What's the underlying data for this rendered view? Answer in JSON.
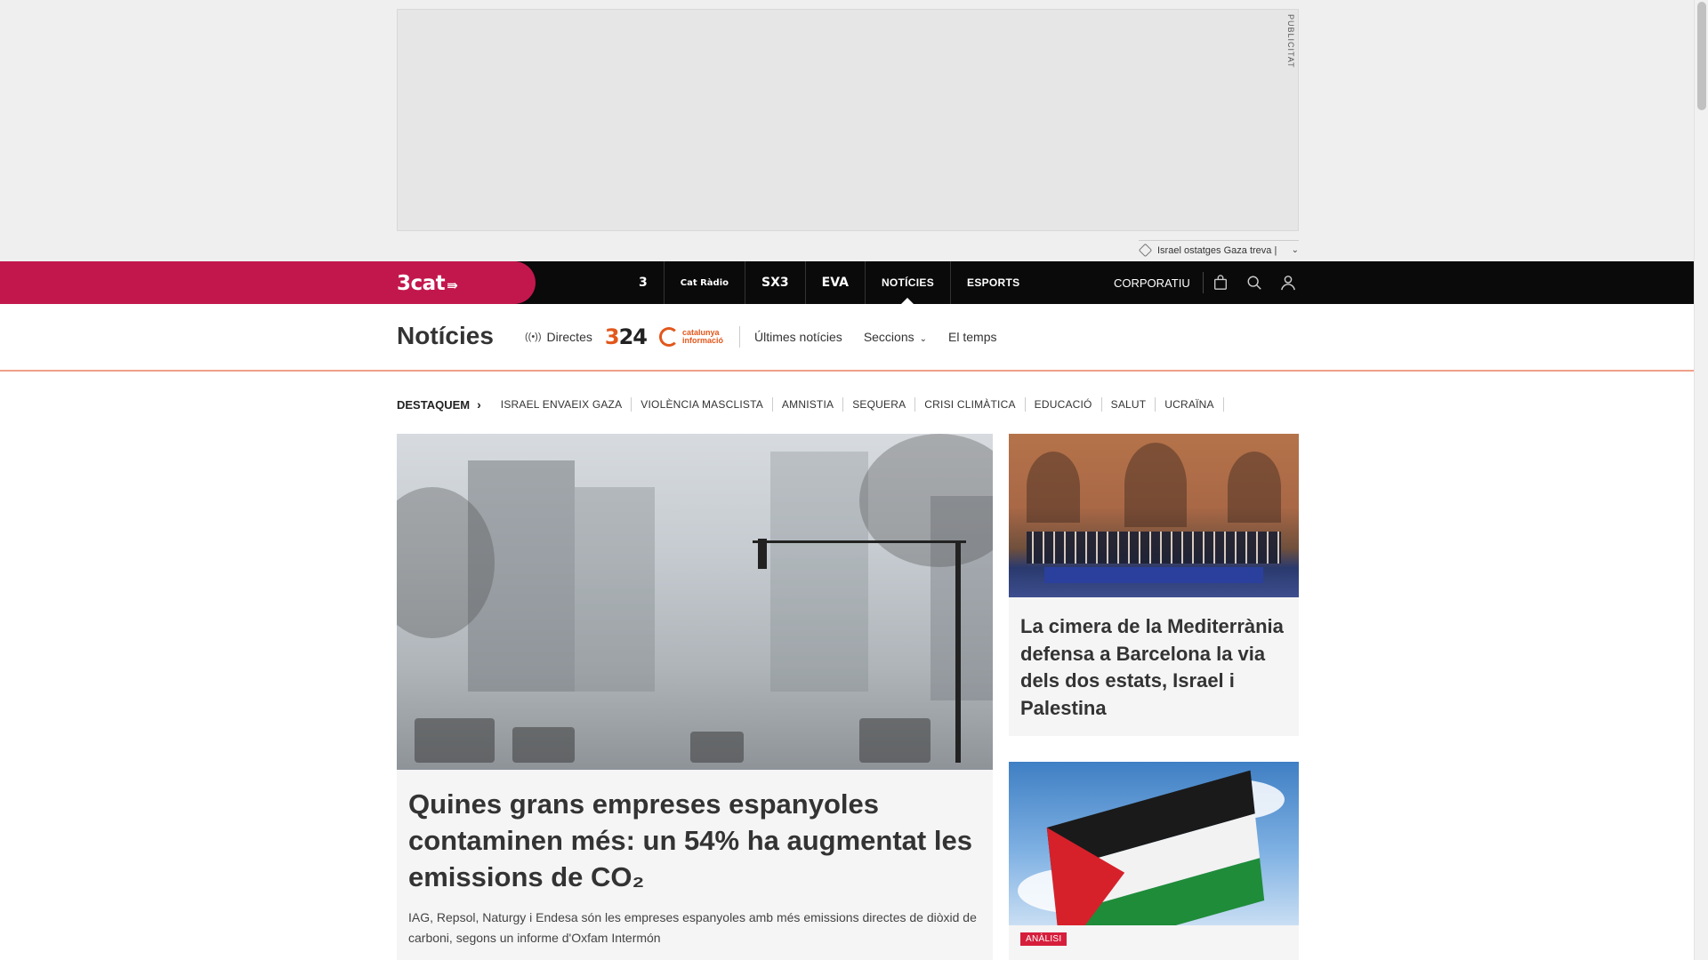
{
  "ad": {
    "label": "PUBLICITAT"
  },
  "ticker": {
    "text": "Israel ostatges Gaza treva |"
  },
  "header": {
    "logo": "3cat",
    "channels": [
      "3",
      "Cat Ràdio",
      "SX3",
      "EVA",
      "NOTÍCIES",
      "ESPORTS"
    ],
    "active_channel": "NOTÍCIES",
    "corporate_label": "CORPORATIU",
    "icons": [
      "shopping-bag-icon",
      "search-icon",
      "user-icon"
    ]
  },
  "section": {
    "title": "Notícies",
    "live_label": "Directes",
    "logo_324": "324",
    "logo_catinfo_line1": "catalunya",
    "logo_catinfo_line2": "informació",
    "links": [
      "Últimes notícies",
      "Seccions",
      "El temps"
    ]
  },
  "highlights": {
    "title": "DESTAQUEM",
    "items": [
      "ISRAEL ENVAEIX GAZA",
      "VIOLÈNCIA MASCLISTA",
      "AMNISTIA",
      "SEQUERA",
      "CRISI CLIMÀTICA",
      "EDUCACIÓ",
      "SALUT",
      "UCRAÏNA"
    ]
  },
  "main_story": {
    "headline": "Quines grans empreses espanyoles contaminen més: un 54% ha augmentat les emissions de CO₂",
    "lede": "IAG, Repsol, Naturgy i Endesa són les empreses espanyoles amb més emissions directes de diòxid de carboni, segons un informe d'Oxfam Intermón"
  },
  "side_stories": [
    {
      "headline": "La cimera de la Mediterrània defensa a Barcelona la via dels dos estats, Israel i Palestina"
    },
    {
      "badge": "ANÀLISI"
    }
  ],
  "colors": {
    "brand": "#c2174d",
    "topbar": "#0a0a0a",
    "accent_rule": "#f0a08a",
    "badge": "#d61e3c"
  }
}
